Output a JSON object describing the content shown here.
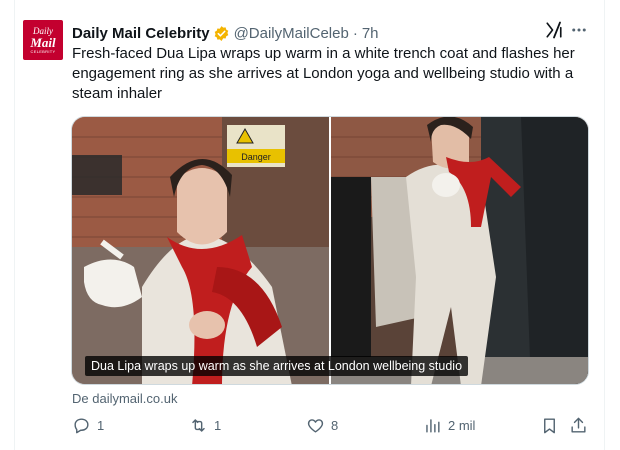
{
  "tweet": {
    "avatar_logo": [
      "Daily",
      "Mail",
      "CELEBRITY"
    ],
    "display_name": "Daily Mail Celebrity",
    "handle": "@DailyMailCeleb",
    "separator": "·",
    "time": "7h",
    "text": "Fresh-faced Dua Lipa wraps up warm in a white trench coat and flashes her engagement ring as she arrives at London yoga and wellbeing studio with a steam inhaler",
    "media": {
      "caption": "Dua Lipa wraps up warm as she arrives at London wellbeing studio",
      "left_sign_text": "Danger"
    },
    "source": "De dailymail.co.uk",
    "actions": {
      "replies": "1",
      "reposts": "1",
      "likes": "8",
      "views": "2 mil"
    }
  },
  "icons": [
    "verified-badge-icon",
    "grok-icon",
    "more-icon",
    "reply-icon",
    "repost-icon",
    "like-icon",
    "views-icon",
    "bookmark-icon",
    "share-icon"
  ],
  "colors": {
    "brand": "#c3002f",
    "verified": "#f4b400",
    "muted": "#536471",
    "text": "#0f1419"
  }
}
